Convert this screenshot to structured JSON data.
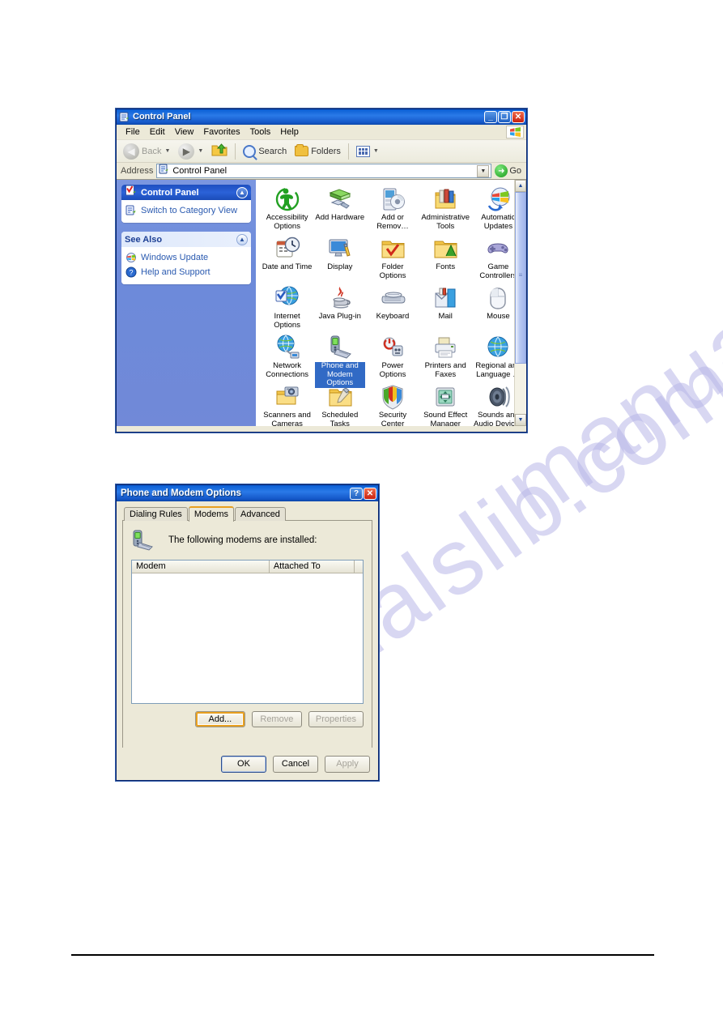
{
  "watermark": {
    "line1": "manualslib.com",
    "line2": "manualslib.com",
    "color": "#b9b7e8"
  },
  "control_panel_window": {
    "title": "Control Panel",
    "title_icon": "control-panel-icon",
    "window_buttons": {
      "minimize": "_",
      "maximize": "❐",
      "close": "✕"
    },
    "menu": [
      "File",
      "Edit",
      "View",
      "Favorites",
      "Tools",
      "Help"
    ],
    "toolbar": {
      "back_label": "Back",
      "forward_label": "",
      "up_label": "",
      "search_label": "Search",
      "folders_label": "Folders",
      "views_label": ""
    },
    "address_bar": {
      "label": "Address",
      "value": "Control Panel",
      "go_label": "Go"
    },
    "sidebar": {
      "panel1": {
        "title": "Control Panel",
        "items": [
          {
            "label": "Switch to Category View",
            "icon": "category-view-icon"
          }
        ]
      },
      "panel2": {
        "title": "See Also",
        "items": [
          {
            "label": "Windows Update",
            "icon": "windows-update-icon"
          },
          {
            "label": "Help and Support",
            "icon": "help-support-icon"
          }
        ]
      }
    },
    "icons": [
      {
        "label": "Accessibility Options",
        "icon": "accessibility-icon",
        "selected": false
      },
      {
        "label": "Add Hardware",
        "icon": "add-hardware-icon",
        "selected": false
      },
      {
        "label": "Add or Remov…",
        "icon": "add-remove-programs-icon",
        "selected": false
      },
      {
        "label": "Administrative Tools",
        "icon": "administrative-tools-icon",
        "selected": false
      },
      {
        "label": "Automatic Updates",
        "icon": "automatic-updates-icon",
        "selected": false
      },
      {
        "label": "Date and Time",
        "icon": "date-time-icon",
        "selected": false
      },
      {
        "label": "Display",
        "icon": "display-icon",
        "selected": false
      },
      {
        "label": "Folder Options",
        "icon": "folder-options-icon",
        "selected": false
      },
      {
        "label": "Fonts",
        "icon": "fonts-icon",
        "selected": false
      },
      {
        "label": "Game Controllers",
        "icon": "game-controllers-icon",
        "selected": false
      },
      {
        "label": "Internet Options",
        "icon": "internet-options-icon",
        "selected": false
      },
      {
        "label": "Java Plug-in",
        "icon": "java-plugin-icon",
        "selected": false
      },
      {
        "label": "Keyboard",
        "icon": "keyboard-icon",
        "selected": false
      },
      {
        "label": "Mail",
        "icon": "mail-icon",
        "selected": false
      },
      {
        "label": "Mouse",
        "icon": "mouse-icon",
        "selected": false
      },
      {
        "label": "Network Connections",
        "icon": "network-connections-icon",
        "selected": false
      },
      {
        "label": "Phone and Modem Options",
        "icon": "phone-modem-icon",
        "selected": true
      },
      {
        "label": "Power Options",
        "icon": "power-options-icon",
        "selected": false
      },
      {
        "label": "Printers and Faxes",
        "icon": "printers-faxes-icon",
        "selected": false
      },
      {
        "label": "Regional and Language …",
        "icon": "regional-language-icon",
        "selected": false
      },
      {
        "label": "Scanners and Cameras",
        "icon": "scanners-cameras-icon",
        "selected": false
      },
      {
        "label": "Scheduled Tasks",
        "icon": "scheduled-tasks-icon",
        "selected": false
      },
      {
        "label": "Security Center",
        "icon": "security-center-icon",
        "selected": false
      },
      {
        "label": "Sound Effect Manager",
        "icon": "sound-effect-manager-icon",
        "selected": false
      },
      {
        "label": "Sounds and Audio Devices",
        "icon": "sounds-audio-devices-icon",
        "selected": false
      }
    ]
  },
  "phone_modem_dialog": {
    "title": "Phone and Modem Options",
    "window_buttons": {
      "help": "?",
      "close": "✕"
    },
    "tabs": [
      {
        "label": "Dialing Rules",
        "active": false
      },
      {
        "label": "Modems",
        "active": true
      },
      {
        "label": "Advanced",
        "active": false
      }
    ],
    "installed_text": "The following modems are  installed:",
    "installed_icon": "modem-icon",
    "list_headers": [
      "Modem",
      "Attached To",
      ""
    ],
    "list_rows": [],
    "action_buttons": [
      {
        "label": "Add...",
        "enabled": true,
        "focused": true
      },
      {
        "label": "Remove",
        "enabled": false,
        "focused": false
      },
      {
        "label": "Properties",
        "enabled": false,
        "focused": false
      }
    ],
    "footer_buttons": [
      {
        "label": "OK",
        "enabled": true,
        "default": true
      },
      {
        "label": "Cancel",
        "enabled": true,
        "default": false
      },
      {
        "label": "Apply",
        "enabled": false,
        "default": false
      }
    ]
  }
}
